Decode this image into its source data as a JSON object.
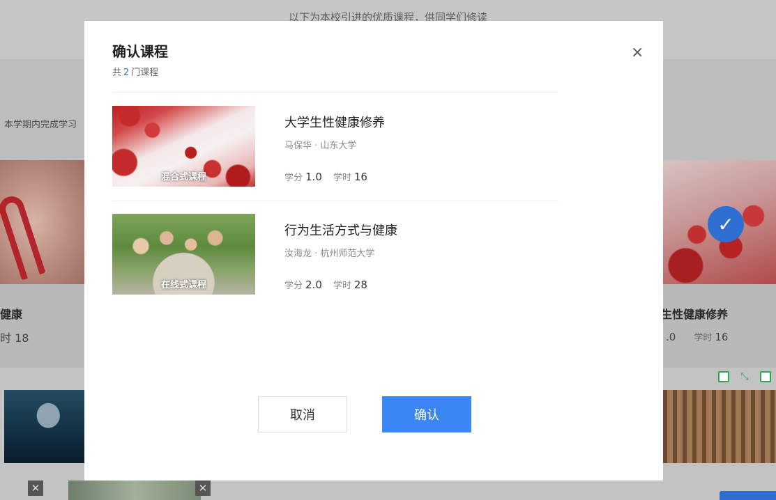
{
  "background": {
    "notice": "以下为本校引进的优质课程，供同学们修读",
    "hint": "本学期内完成学习",
    "left_card": {
      "title": "健康",
      "meta": "时 18"
    },
    "right_card": {
      "title": "生性健康修养",
      "credit": ".0",
      "hours_label": "学时",
      "hours": "16"
    }
  },
  "modal": {
    "title": "确认课程",
    "count_prefix": "共",
    "count": "2",
    "count_suffix": "门课程",
    "courses": [
      {
        "title": "大学生性健康修养",
        "teacher_school": "马保华 · 山东大学",
        "tag": "混合式课程",
        "credit_label": "学分",
        "credit": "1.0",
        "hours_label": "学时",
        "hours": "16"
      },
      {
        "title": "行为生活方式与健康",
        "teacher_school": "汝海龙 · 杭州师范大学",
        "tag": "在线式课程",
        "credit_label": "学分",
        "credit": "2.0",
        "hours_label": "学时",
        "hours": "28"
      }
    ],
    "cancel_label": "取消",
    "confirm_label": "确认",
    "close_icon": "×"
  },
  "colors": {
    "accent": "#3a86f5",
    "count_blue": "#2e6fd1",
    "tool_green": "#2fa84f"
  }
}
